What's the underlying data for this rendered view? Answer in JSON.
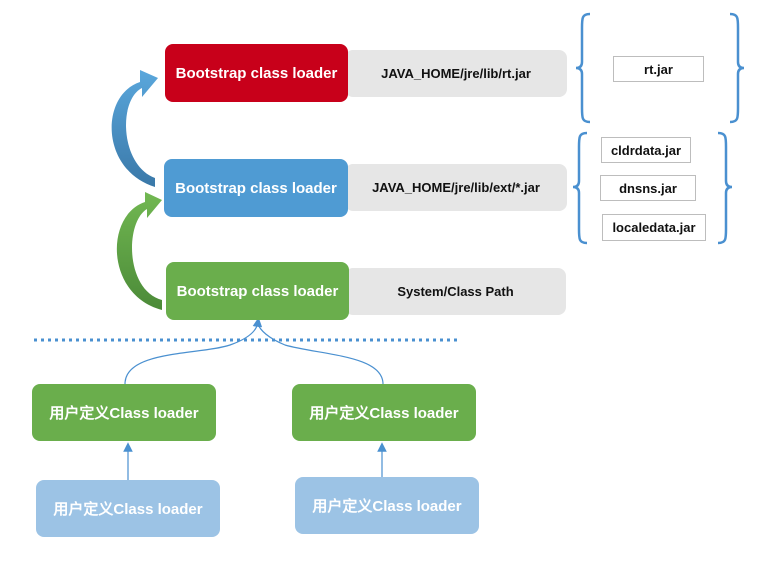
{
  "colors": {
    "red": "#c8001a",
    "blue": "#4f9bd3",
    "green": "#6aae4c",
    "light_blue": "#9cc3e5",
    "gray": "#e6e6e6",
    "brace": "#4a90d0"
  },
  "hierarchy": [
    {
      "label": "Bootstrap class loader",
      "path": "JAVA_HOME/jre/lib/rt.jar",
      "color": "red"
    },
    {
      "label": "Bootstrap class loader",
      "path": "JAVA_HOME/jre/lib/ext/*.jar",
      "color": "blue"
    },
    {
      "label": "Bootstrap class loader",
      "path": "System/Class Path",
      "color": "green"
    }
  ],
  "jars_top": [
    "rt.jar"
  ],
  "jars_ext": [
    "cldrdata.jar",
    "dnsns.jar",
    "localedata.jar"
  ],
  "user_loaders": {
    "parents": [
      "用户定义Class loader",
      "用户定义Class loader"
    ],
    "children": [
      "用户定义Class loader",
      "用户定义Class loader"
    ]
  }
}
